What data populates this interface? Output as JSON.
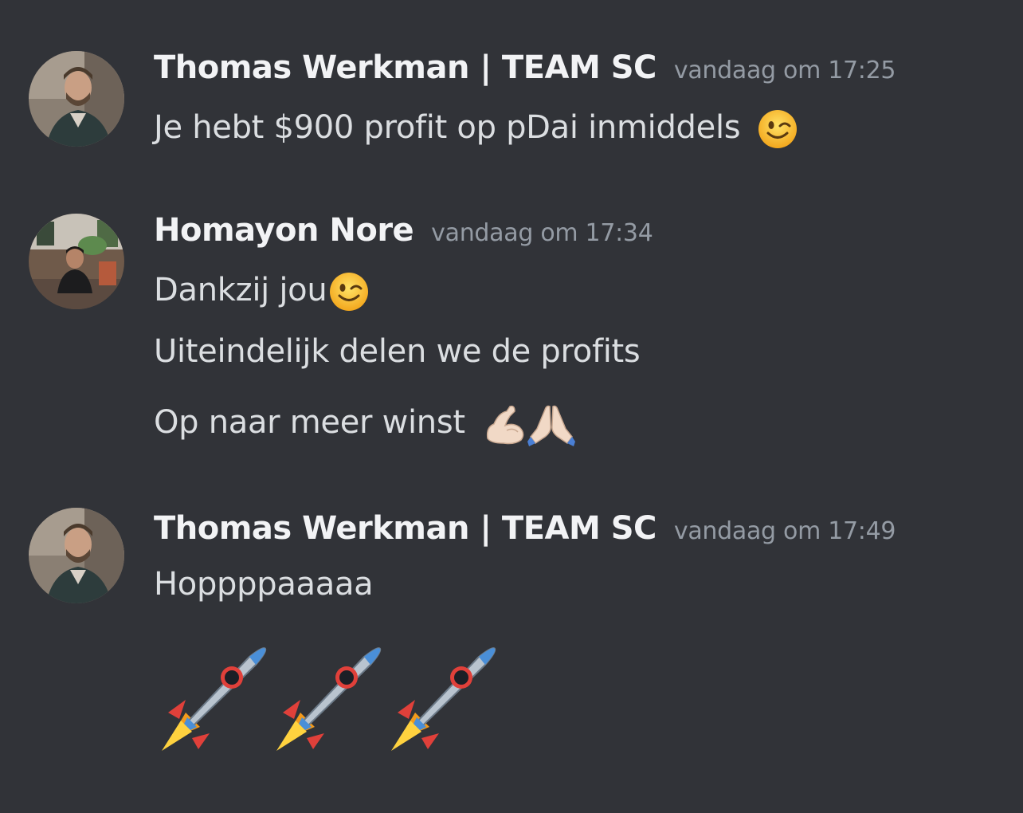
{
  "messages": [
    {
      "author": "Thomas Werkman | TEAM SC",
      "timestamp": "vandaag om 17:25",
      "lines": [
        "Je hebt $900 profit op pDai inmiddels"
      ],
      "emojis": [
        "winking-face"
      ]
    },
    {
      "author": "Homayon Nore",
      "timestamp": "vandaag om 17:34",
      "lines": [
        "Dankzij jou",
        "Uiteindelijk delen we de profits",
        "Op naar meer winst"
      ],
      "emojis": [
        "winking-face",
        "flexed-biceps",
        "folded-hands"
      ]
    },
    {
      "author": "Thomas Werkman | TEAM SC",
      "timestamp": "vandaag om 17:49",
      "lines": [
        "Hoppppaaaaa"
      ],
      "emojis": [
        "rocket",
        "rocket",
        "rocket"
      ]
    }
  ],
  "colors": {
    "background": "#313338",
    "username": "#f2f3f5",
    "timestamp": "#949ba4",
    "message_text": "#dbdee1"
  }
}
